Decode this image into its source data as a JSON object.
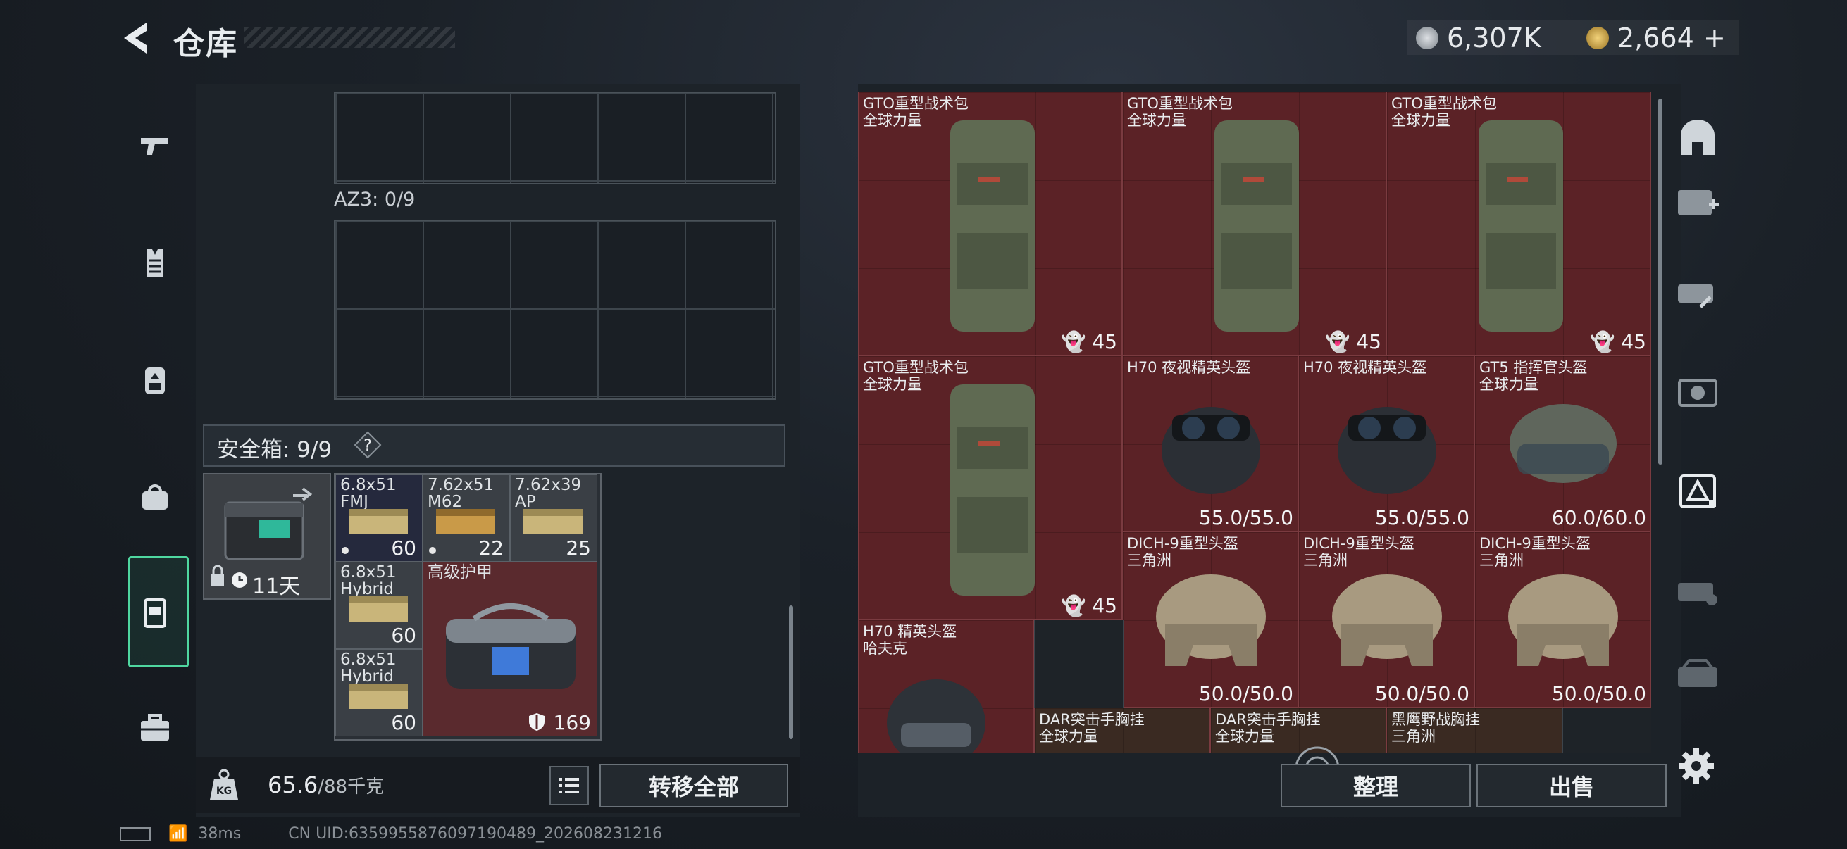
{
  "header": {
    "title": "仓库",
    "currency_silver": "6,307K",
    "currency_gold": "2,664",
    "currency_add": "+"
  },
  "left_categories": [
    {
      "icon": "pistol-icon"
    },
    {
      "icon": "vest-icon"
    },
    {
      "icon": "backpack-icon"
    },
    {
      "icon": "bag-icon"
    },
    {
      "icon": "safe-box-icon",
      "active": true
    },
    {
      "icon": "toolbox-icon"
    }
  ],
  "backpack": {
    "az3_label": "AZ3: 0/9",
    "safe_box_label": "安全箱: 9/9",
    "safe_box_help": "?",
    "safe_box_timer": "11天",
    "safe_items": [
      {
        "name": "6.8x51\nFMJ",
        "count": "60"
      },
      {
        "name": "7.62x51\nM62",
        "count": "22"
      },
      {
        "name": "7.62x39\nAP",
        "count": "25"
      },
      {
        "name": "6.8x51\nHybrid",
        "count": "60"
      },
      {
        "name": "6.8x51\nHybrid",
        "count": "60"
      }
    ],
    "armor_item": {
      "name": "高级护甲",
      "value": "169"
    },
    "weight_value": "65.6",
    "weight_max": "/88千克",
    "transfer_all": "转移全部"
  },
  "stash": {
    "items": [
      {
        "name": "GTO重型战术包",
        "sub": "全球力量",
        "value": "45"
      },
      {
        "name": "GTO重型战术包",
        "sub": "全球力量",
        "value": "45"
      },
      {
        "name": "GTO重型战术包",
        "sub": "全球力量",
        "value": "45"
      },
      {
        "name": "GTO重型战术包",
        "sub": "全球力量",
        "value": "45"
      },
      {
        "name": "H70 夜视精英头盔",
        "sub": "",
        "value": "55.0/55.0"
      },
      {
        "name": "H70 夜视精英头盔",
        "sub": "",
        "value": "55.0/55.0"
      },
      {
        "name": "GT5 指挥官头盔",
        "sub": "全球力量",
        "value": "60.0/60.0"
      },
      {
        "name": "DICH-9重型头盔",
        "sub": "三角洲",
        "value": "50.0/50.0"
      },
      {
        "name": "DICH-9重型头盔",
        "sub": "三角洲",
        "value": "50.0/50.0"
      },
      {
        "name": "DICH-9重型头盔",
        "sub": "三角洲",
        "value": "50.0/50.0"
      },
      {
        "name": "H70 精英头盔",
        "sub": "哈夫克",
        "value": ""
      },
      {
        "name": "DAR突击手胸挂",
        "sub": "全球力量",
        "value": ""
      },
      {
        "name": "DAR突击手胸挂",
        "sub": "全球力量",
        "value": ""
      },
      {
        "name": "黑鹰野战胸挂",
        "sub": "三角洲",
        "value": ""
      }
    ],
    "sort_label": "整理",
    "sell_label": "出售"
  },
  "status": {
    "ping": "38ms",
    "uid": "CN UID:6359955876097190489_202608231216"
  },
  "colors": {
    "accent": "#4fd7a0",
    "item_red": "#5b2226"
  }
}
